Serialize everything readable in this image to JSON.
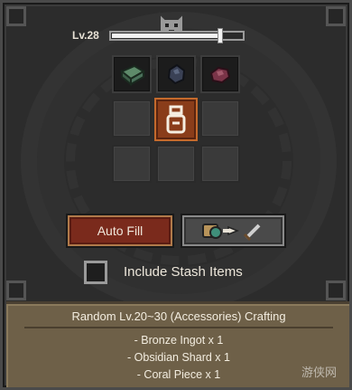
{
  "header": {
    "level_label": "Lv.28",
    "xp_progress": 0.82
  },
  "materials": [
    {
      "name": "Bronze Ingot",
      "icon": "bronze-ingot-icon"
    },
    {
      "name": "Obsidian Shard",
      "icon": "obsidian-shard-icon"
    },
    {
      "name": "Coral Piece",
      "icon": "coral-piece-icon"
    }
  ],
  "result_slot": {
    "icon": "accessory-pouch-icon"
  },
  "buttons": {
    "auto_fill": "Auto Fill",
    "craft_icon": "craft-arrow-sword-icon"
  },
  "stash": {
    "label": "Include Stash Items",
    "checked": false
  },
  "recipe": {
    "title": "Random Lv.20~30 (Accessories) Crafting",
    "items": [
      "- Bronze Ingot x 1",
      "- Obsidian Shard x 1",
      "- Coral Piece x 1"
    ]
  },
  "watermark": "游侠网",
  "colors": {
    "selected_slot": "#8a3d1a",
    "auto_fill_bg": "#7a2a1c",
    "info_bg": "#6e6048"
  }
}
